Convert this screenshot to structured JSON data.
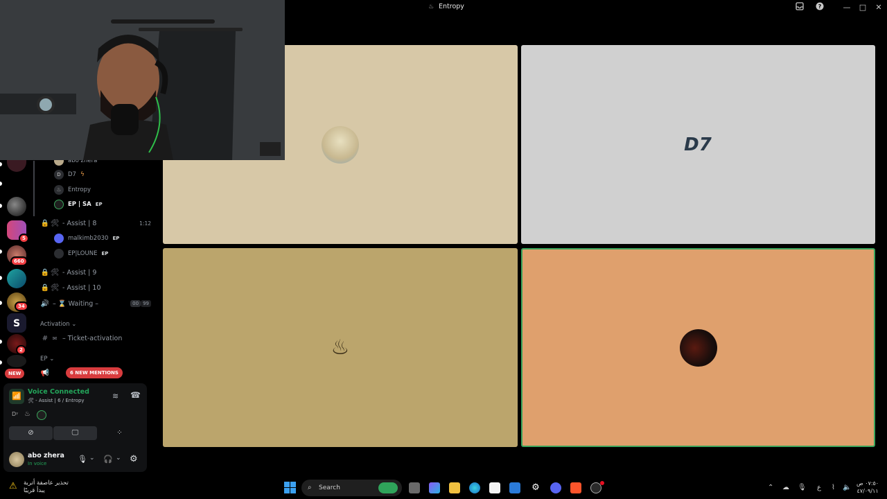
{
  "window": {
    "title": "Entropy",
    "title_icon": "entropy-logo-icon"
  },
  "titlebar_controls": [
    "inbox-icon",
    "help-icon",
    "minimize-icon",
    "maximize-icon",
    "close-icon"
  ],
  "servers": [
    {
      "badge": ""
    },
    {
      "badge": "5"
    },
    {
      "badge": "660"
    },
    {
      "badge": ""
    },
    {
      "badge": "34"
    },
    {
      "badge": ""
    },
    {
      "badge": "2"
    },
    {
      "badge": ""
    }
  ],
  "new_pill": "NEW",
  "voice_members_top": [
    {
      "name": "abo zhera",
      "color": "#b9a98a"
    },
    {
      "name": "D7",
      "color": "#2b2d31"
    },
    {
      "name": "Entropy",
      "color": "#2b2d31"
    },
    {
      "name": "EP | SA",
      "tag": "EP",
      "color": "#1f1f1f"
    }
  ],
  "channels": {
    "assist8": {
      "name": "- Assist | 8",
      "time": "1:12"
    },
    "assist8_members": [
      {
        "name": "malkimb2030",
        "tag": "EP",
        "color": "#5865f2"
      },
      {
        "name": "EP|LOUNE",
        "tag": "EP",
        "color": "#2b2d31"
      }
    ],
    "assist9": "- Assist | 9",
    "assist10": "- Assist | 10",
    "waiting": {
      "name": "– ⌛ Waiting –",
      "count": "00",
      "limit": "99"
    },
    "category_activation": "Activation",
    "ticket": "– Ticket-activation",
    "category_ep": "EP",
    "mentions": "6 NEW MENTIONS"
  },
  "voice": {
    "status": "Voice Connected",
    "location": "- Assist | 6 / Entropy"
  },
  "user": {
    "name": "abo zhera",
    "status": "In voice"
  },
  "tiles": [
    {
      "color": "#d7c8a7",
      "avatar": "frog-guitar-avatar"
    },
    {
      "color": "#d0d0d0",
      "avatar": "d7-logo-avatar",
      "label": "D7"
    },
    {
      "color": "#bba56c",
      "avatar": "entropy-logo-avatar"
    },
    {
      "color": "#dfa06d",
      "avatar": "dark-circle-avatar"
    }
  ],
  "taskbar": {
    "weather_line1": "تحذير عاصفة أتربة",
    "weather_line2": "يبدأ قريبًا",
    "search_placeholder": "Search",
    "clock_time": "٠٧:٥٠ ص",
    "clock_date": "٤٧/٠٩/١١",
    "lang": "ع"
  }
}
